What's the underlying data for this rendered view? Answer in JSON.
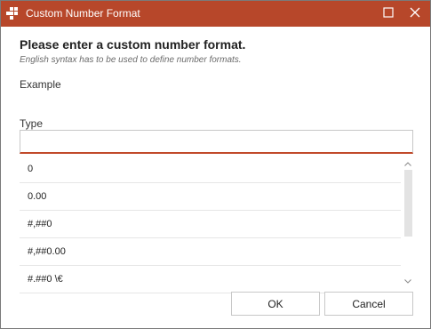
{
  "window": {
    "title": "Custom Number Format"
  },
  "dialog": {
    "heading": "Please enter a custom number format.",
    "subheading": "English syntax has to be used to define number formats.",
    "example_label": "Example",
    "type_label": "Type",
    "type_value": "",
    "formats": [
      "0",
      "0.00",
      "#,##0",
      "#,##0.00",
      "#.##0 \\€"
    ]
  },
  "buttons": {
    "ok_label": "OK",
    "cancel_label": "Cancel"
  },
  "colors": {
    "titlebar": "#b7472a",
    "input_underline": "#c14a2a"
  },
  "icons": {
    "app": "office-app-icon",
    "maximize": "maximize-icon",
    "close": "close-icon",
    "scroll_up": "chevron-up-icon",
    "scroll_down": "chevron-down-icon"
  }
}
